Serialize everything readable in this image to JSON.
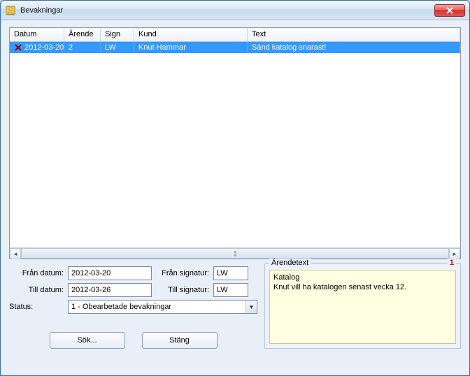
{
  "window": {
    "title": "Bevakningar"
  },
  "table": {
    "headers": {
      "datum": "Datum",
      "arende": "Ärende",
      "sign": "Sign",
      "kund": "Kund",
      "text": "Text"
    },
    "rows": [
      {
        "datum": "2012-03-20",
        "arende": "2",
        "sign": "LW",
        "kund": "Knut Hammar",
        "text": "Sänd katalog snarast!"
      }
    ]
  },
  "filters": {
    "fran_datum_label": "Från datum:",
    "fran_datum_value": "2012-03-20",
    "till_datum_label": "Till datum:",
    "till_datum_value": "2012-03-26",
    "fran_signatur_label": "Från signatur:",
    "fran_signatur_value": "LW",
    "till_signatur_label": "Till signatur:",
    "till_signatur_value": "LW",
    "status_label": "Status:",
    "status_value": "1 - Obearbetade bevakningar"
  },
  "arende": {
    "legend": "Ärendetext",
    "count": "1",
    "body": "Katalog\nKnut vill ha katalogen senast vecka 12."
  },
  "buttons": {
    "search": "Sök...",
    "close": "Stäng"
  }
}
